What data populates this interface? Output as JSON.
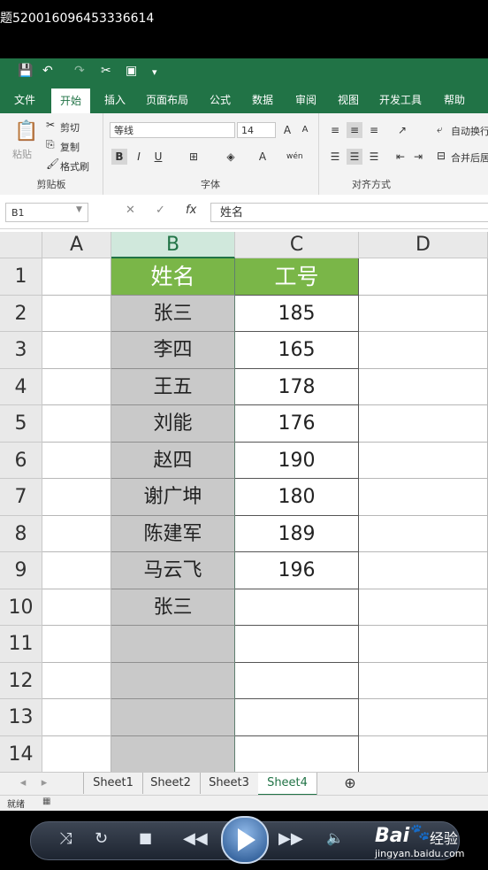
{
  "video_title": "题520016096453336614",
  "excel": {
    "tabs": [
      "文件",
      "开始",
      "插入",
      "页面布局",
      "公式",
      "数据",
      "审阅",
      "视图",
      "开发工具",
      "帮助"
    ],
    "active_tab": "开始",
    "clipboard": {
      "paste": "粘贴",
      "cut": "剪切",
      "copy": "复制",
      "format_painter": "格式刷",
      "label": "剪贴板"
    },
    "font": {
      "name": "等线",
      "size": "14",
      "label": "字体",
      "bold": "B",
      "italic": "I",
      "underline": "U",
      "wen": "wén"
    },
    "align": {
      "wrap": "自动换行",
      "merge": "合并后居",
      "label": "对齐方式"
    },
    "name_box": "B1",
    "formula_value": "姓名",
    "columns": [
      "A",
      "B",
      "C",
      "D"
    ],
    "rows": [
      "1",
      "2",
      "3",
      "4",
      "5",
      "6",
      "7",
      "8",
      "9",
      "10",
      "11",
      "12",
      "13",
      "14"
    ],
    "col_b": [
      "姓名",
      "张三",
      "李四",
      "王五",
      "刘能",
      "赵四",
      "谢广坤",
      "陈建军",
      "马云飞",
      "张三",
      "",
      "",
      "",
      ""
    ],
    "col_c": [
      "工号",
      "185",
      "165",
      "178",
      "176",
      "190",
      "180",
      "189",
      "196",
      "",
      "",
      "",
      "",
      ""
    ],
    "sheets": [
      "Sheet1",
      "Sheet2",
      "Sheet3",
      "Sheet4"
    ],
    "active_sheet": "Sheet4",
    "status": "就绪"
  },
  "watermark": {
    "brand": "Bai",
    "brand2": "经验",
    "url": "jingyan.baidu.com"
  },
  "colors": {
    "excel_green": "#217346",
    "header_fill": "#7ab648",
    "selection_gray": "#c9c9c9"
  }
}
